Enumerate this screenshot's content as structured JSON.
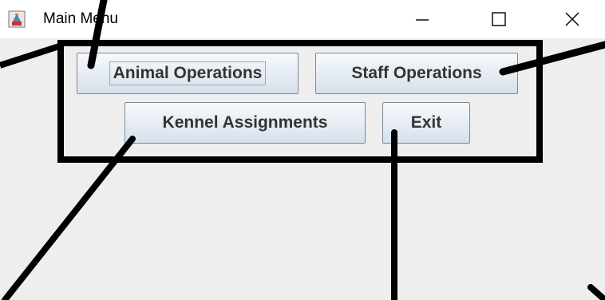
{
  "window": {
    "title": "Main Menu",
    "icon": "java-coffee-cup-icon",
    "controls": {
      "minimize_icon": "minimize-icon",
      "maximize_icon": "maximize-icon",
      "close_icon": "close-icon"
    }
  },
  "menu": {
    "animal_operations": "Animal Operations",
    "staff_operations": "Staff Operations",
    "kennel_assignments": "Kennel Assignments",
    "exit": "Exit"
  },
  "colors": {
    "background": "#eeeeee",
    "titlebar": "#ffffff",
    "button_text": "#333333",
    "annotation": "#000000"
  }
}
